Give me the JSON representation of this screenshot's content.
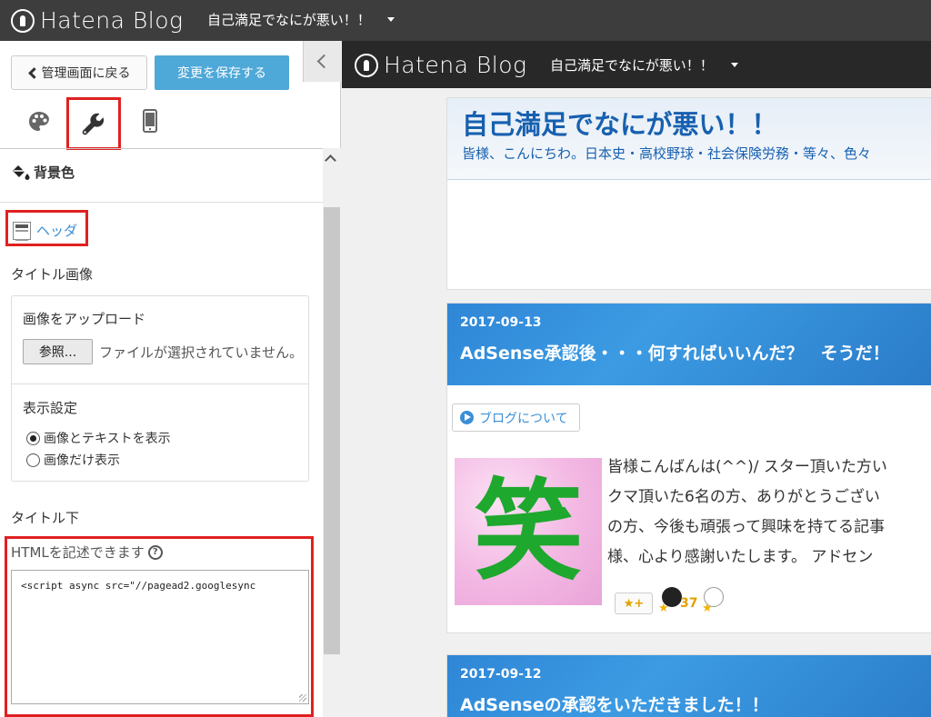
{
  "topbar": {
    "logo_text": "Hatena Blog",
    "blog_name": "自己満足でなにが悪い！！"
  },
  "editor": {
    "back_label": "管理画面に戻る",
    "save_label": "変更を保存する",
    "tabs": [
      "palette-icon",
      "wrench-icon",
      "smartphone-icon"
    ],
    "background_label": "背景色",
    "header_link": "ヘッダ",
    "title_image_label": "タイトル画像",
    "upload_label": "画像をアップロード",
    "browse_label": "参照...",
    "no_file_text": "ファイルが選択されていません。",
    "display_settings_label": "表示設定",
    "radio_options": [
      "画像とテキストを表示",
      "画像だけ表示"
    ],
    "radio_selected": 0,
    "below_title_label": "タイトル下",
    "html_hint": "HTMLを記述できます",
    "html_value": "<script async src=\"//pagead2.googlesync"
  },
  "preview": {
    "logo_text": "Hatena Blog",
    "blog_name": "自己満足でなにが悪い！！",
    "blog_title": "自己満足でなにが悪い！！",
    "blog_description": "皆様、こんにちわ。日本史・高校野球・社会保険労務・等々、色々",
    "entries": [
      {
        "date": "2017-09-13",
        "title": "AdSense承認後・・・何すればいいんだ？　そうだ！",
        "category": "ブログについて",
        "thumb_char": "笑",
        "body_lines": [
          "皆様こんばんは(^^)/ スター頂いた方い",
          "クマ頂いた6名の方、ありがとうござい",
          "の方、今後も頑張って興味を持てる記事",
          "様、心より感謝いたします。 アドセン"
        ],
        "star_button": "★+",
        "star_count": "37"
      },
      {
        "date": "2017-09-12",
        "title": "AdSenseの承認をいただきました！！"
      }
    ]
  },
  "colors": {
    "topbar": "#3d3d3d",
    "save_button": "#4ea8d8",
    "highlight_box": "#e02020",
    "link": "#3a8fd6",
    "blog_title": "#1760b0"
  }
}
